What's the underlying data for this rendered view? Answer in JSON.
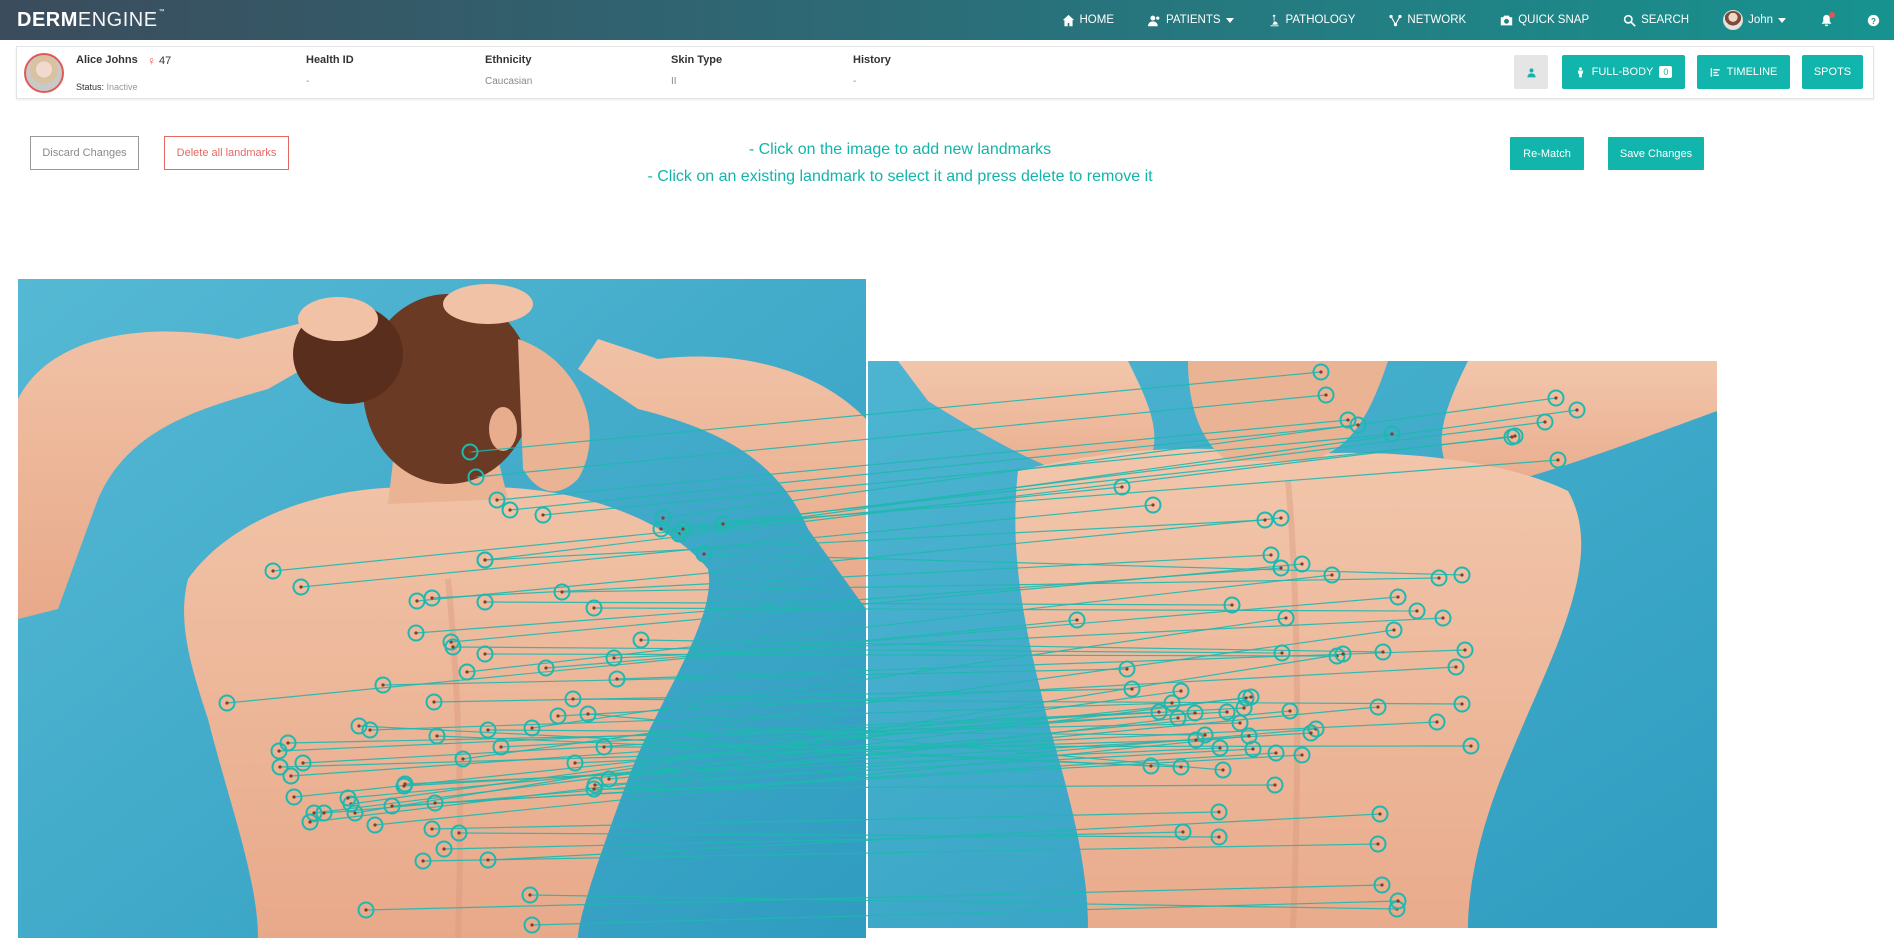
{
  "brand": {
    "part1": "DERM",
    "part2": "ENGINE",
    "tm": "™"
  },
  "nav": {
    "home": "HOME",
    "patients": "PATIENTS",
    "pathology": "PATHOLOGY",
    "network": "NETWORK",
    "quick_snap": "QUICK SNAP",
    "search": "SEARCH",
    "user": "John"
  },
  "patient": {
    "name": "Alice Johns",
    "age": "47",
    "status_label": "Status:",
    "status_value": "Inactive",
    "fields": [
      {
        "label": "Health ID",
        "value": "-"
      },
      {
        "label": "Ethnicity",
        "value": "Caucasian"
      },
      {
        "label": "Skin Type",
        "value": "II"
      },
      {
        "label": "History",
        "value": "-"
      }
    ],
    "buttons": {
      "full_body": "FULL-BODY",
      "full_body_count": "0",
      "timeline": "TIMELINE",
      "spots": "SPOTS"
    }
  },
  "actions": {
    "discard": "Discard Changes",
    "delete_all": "Delete all landmarks",
    "rematch": "Re-Match",
    "save": "Save Changes"
  },
  "instructions": {
    "line1": "- Click on the image to add new landmarks",
    "line2": "- Click on an existing landmark to select it and press delete to remove it"
  },
  "colors": {
    "accent": "#12b5ab",
    "danger": "#e46863",
    "landmark": "#1fb8b0"
  },
  "landmark_pairs": [
    [
      470,
      452,
      1321,
      372
    ],
    [
      476,
      477,
      1326,
      395
    ],
    [
      497,
      500,
      1348,
      420
    ],
    [
      510,
      510,
      1358,
      425
    ],
    [
      543,
      515,
      1392,
      434
    ],
    [
      273,
      571,
      1122,
      487
    ],
    [
      301,
      587,
      1153,
      505
    ],
    [
      485,
      560,
      1265,
      520
    ],
    [
      663,
      518,
      1556,
      398
    ],
    [
      679,
      534,
      1577,
      410
    ],
    [
      485,
      560,
      1515,
      436
    ],
    [
      432,
      598,
      1271,
      555
    ],
    [
      417,
      601,
      1281,
      518
    ],
    [
      485,
      602,
      1232,
      605
    ],
    [
      562,
      592,
      1439,
      578
    ],
    [
      594,
      608,
      1417,
      611
    ],
    [
      661,
      529,
      1512,
      437
    ],
    [
      683,
      529,
      1545,
      422
    ],
    [
      723,
      524,
      1558,
      460
    ],
    [
      704,
      554,
      1462,
      575
    ],
    [
      227,
      703,
      1077,
      620
    ],
    [
      416,
      633,
      1281,
      568
    ],
    [
      451,
      642,
      1302,
      564
    ],
    [
      467,
      672,
      1332,
      575
    ],
    [
      383,
      685,
      1127,
      669
    ],
    [
      434,
      702,
      1132,
      689
    ],
    [
      453,
      647,
      1282,
      653
    ],
    [
      485,
      654,
      1337,
      656
    ],
    [
      546,
      668,
      1398,
      597
    ],
    [
      614,
      658,
      1443,
      618
    ],
    [
      641,
      640,
      1383,
      652
    ],
    [
      617,
      679,
      1465,
      650
    ],
    [
      370,
      730,
      1172,
      703
    ],
    [
      558,
      716,
      1456,
      667
    ],
    [
      573,
      699,
      1462,
      704
    ],
    [
      437,
      736,
      1181,
      767
    ],
    [
      575,
      763,
      1437,
      722
    ],
    [
      604,
      747,
      1471,
      746
    ],
    [
      359,
      726,
      1151,
      766
    ],
    [
      488,
      730,
      1205,
      735
    ],
    [
      279,
      751,
      1159,
      712
    ],
    [
      532,
      728,
      1286,
      618
    ],
    [
      280,
      767,
      1196,
      740
    ],
    [
      588,
      714,
      1223,
      770
    ],
    [
      501,
      747,
      1244,
      708
    ],
    [
      294,
      797,
      1246,
      698
    ],
    [
      291,
      776,
      1195,
      713
    ],
    [
      405,
      784,
      1220,
      748
    ],
    [
      392,
      806,
      1276,
      753
    ],
    [
      351,
      804,
      1181,
      691
    ],
    [
      314,
      813,
      1251,
      697
    ],
    [
      355,
      813,
      1343,
      654
    ],
    [
      348,
      798,
      1290,
      711
    ],
    [
      324,
      813,
      1316,
      729
    ],
    [
      310,
      822,
      1178,
      718
    ],
    [
      375,
      825,
      1249,
      736
    ],
    [
      404,
      786,
      1311,
      733
    ],
    [
      435,
      803,
      1302,
      755
    ],
    [
      463,
      759,
      1394,
      630
    ],
    [
      595,
      785,
      1253,
      749
    ],
    [
      609,
      779,
      1378,
      707
    ],
    [
      594,
      789,
      1275,
      785
    ],
    [
      432,
      829,
      1219,
      812
    ],
    [
      444,
      849,
      1183,
      832
    ],
    [
      423,
      861,
      1378,
      844
    ],
    [
      488,
      860,
      1380,
      814
    ],
    [
      459,
      833,
      1219,
      837
    ],
    [
      366,
      910,
      1382,
      885
    ],
    [
      530,
      895,
      1397,
      909
    ],
    [
      532,
      925,
      1398,
      901
    ],
    [
      288,
      743,
      1240,
      723
    ],
    [
      303,
      763,
      1227,
      712
    ]
  ]
}
